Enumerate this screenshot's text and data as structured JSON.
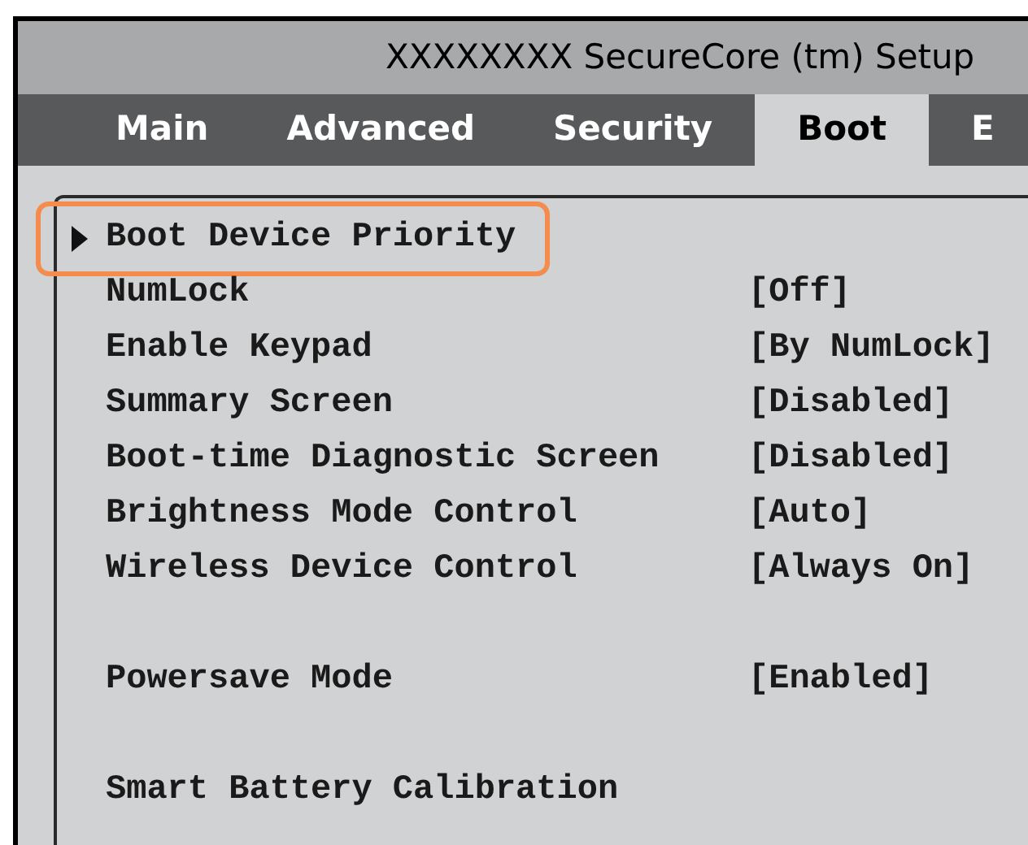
{
  "window": {
    "title": "XXXXXXXX SecureCore (tm) Setup"
  },
  "tabs": [
    {
      "label": "Main",
      "selected": false
    },
    {
      "label": "Advanced",
      "selected": false
    },
    {
      "label": "Security",
      "selected": false
    },
    {
      "label": "Boot",
      "selected": true
    },
    {
      "label": "E",
      "selected": false
    }
  ],
  "groups": [
    {
      "items": [
        {
          "kind": "submenu",
          "label": "Boot Device Priority",
          "highlighted": true
        },
        {
          "kind": "setting",
          "label": "NumLock",
          "value": "[Off]"
        },
        {
          "kind": "setting",
          "label": "Enable Keypad",
          "value": "[By NumLock]"
        },
        {
          "kind": "setting",
          "label": "Summary Screen",
          "value": "[Disabled]"
        },
        {
          "kind": "setting",
          "label": "Boot-time Diagnostic Screen",
          "value": "[Disabled]"
        },
        {
          "kind": "setting",
          "label": "Brightness Mode Control",
          "value": "[Auto]"
        },
        {
          "kind": "setting",
          "label": "Wireless Device Control",
          "value": "[Always On]"
        }
      ]
    },
    {
      "items": [
        {
          "kind": "setting",
          "label": "Powersave Mode",
          "value": "[Enabled]"
        }
      ]
    },
    {
      "items": [
        {
          "kind": "action",
          "label": "Smart Battery Calibration"
        }
      ]
    }
  ]
}
